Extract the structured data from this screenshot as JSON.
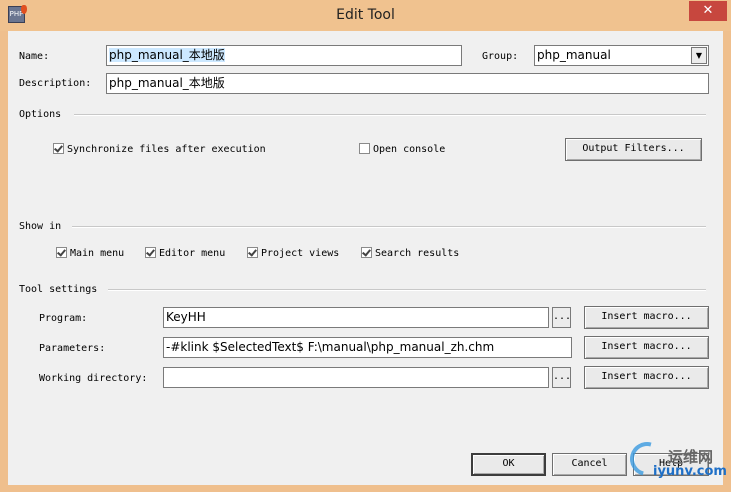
{
  "window": {
    "title": "Edit Tool",
    "app_icon_text": "PHP",
    "close_glyph": "✕"
  },
  "form": {
    "name_label": "Name:",
    "name_value": "php_manual_本地版",
    "group_label": "Group:",
    "group_value": "php_manual",
    "description_label": "Description:",
    "description_value": "php_manual_本地版"
  },
  "options": {
    "section_label": "Options",
    "sync_files_label": "Synchronize files after execution",
    "sync_files_checked": true,
    "open_console_label": "Open console",
    "open_console_checked": false,
    "output_filters_button": "Output Filters..."
  },
  "show_in": {
    "section_label": "Show in",
    "items": [
      {
        "label": "Main menu",
        "checked": true
      },
      {
        "label": "Editor menu",
        "checked": true
      },
      {
        "label": "Project views",
        "checked": true
      },
      {
        "label": "Search results",
        "checked": true
      }
    ]
  },
  "tool_settings": {
    "section_label": "Tool settings",
    "program_label": "Program:",
    "program_value": "KeyHH",
    "parameters_label": "Parameters:",
    "parameters_value": "-#klink $SelectedText$ F:\\manual\\php_manual_zh.chm",
    "working_directory_label": "Working directory:",
    "working_directory_value": "",
    "browse_glyph": "...",
    "insert_macro_button": "Insert macro..."
  },
  "buttons": {
    "ok": "OK",
    "cancel": "Cancel",
    "help": "Help"
  },
  "watermark": {
    "line1": "运维网",
    "line2": "iyunv.com"
  },
  "colors": {
    "title_bar": "#f0c28f",
    "close_button": "#c7473e",
    "selection": "#cce8ff",
    "dialog_bg": "#f0f0f0"
  }
}
